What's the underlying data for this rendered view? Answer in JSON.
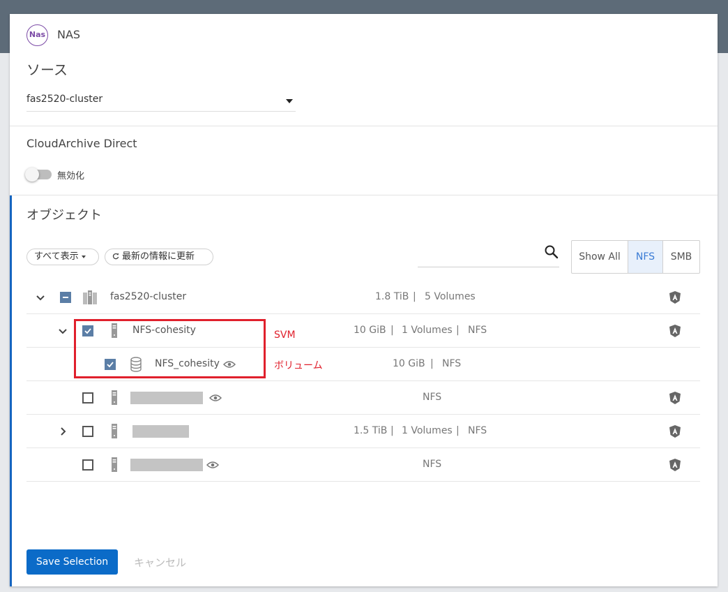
{
  "header": {
    "badge_text": "Nas",
    "title": "NAS",
    "source_label": "ソース",
    "source_value": "fas2520-cluster",
    "cloudarchive_title": "CloudArchive Direct",
    "toggle_label": "無効化"
  },
  "objects": {
    "title": "オブジェクト",
    "filter_label": "すべて表示",
    "refresh_label": "最新の情報に更新",
    "search_placeholder": "",
    "segments": [
      "Show All",
      "NFS",
      "SMB"
    ],
    "selected_segment": "NFS"
  },
  "tree": {
    "root": {
      "name": "fas2520-cluster",
      "size": "1.8 TiB",
      "volumes": "5 Volumes"
    },
    "svm1": {
      "name": "NFS-cohesity",
      "size": "10 GiB",
      "volumes": "1 Volumes",
      "protocol": "NFS"
    },
    "vol1": {
      "name": "NFS_cohesity",
      "size": "10 GiB",
      "protocol": "NFS"
    },
    "row3": {
      "protocol": "NFS"
    },
    "row4": {
      "size": "1.5 TiB",
      "volumes": "1 Volumes",
      "protocol": "NFS"
    },
    "row5": {
      "protocol": "NFS"
    },
    "separator": "|"
  },
  "annotations": {
    "svm": "SVM",
    "volume": "ボリューム"
  },
  "footer": {
    "save_label": "Save Selection",
    "cancel_label": "キャンセル"
  },
  "colors": {
    "accent": "#0b6bc8",
    "annotation": "#e0202c",
    "topbar": "#5d6b78"
  }
}
